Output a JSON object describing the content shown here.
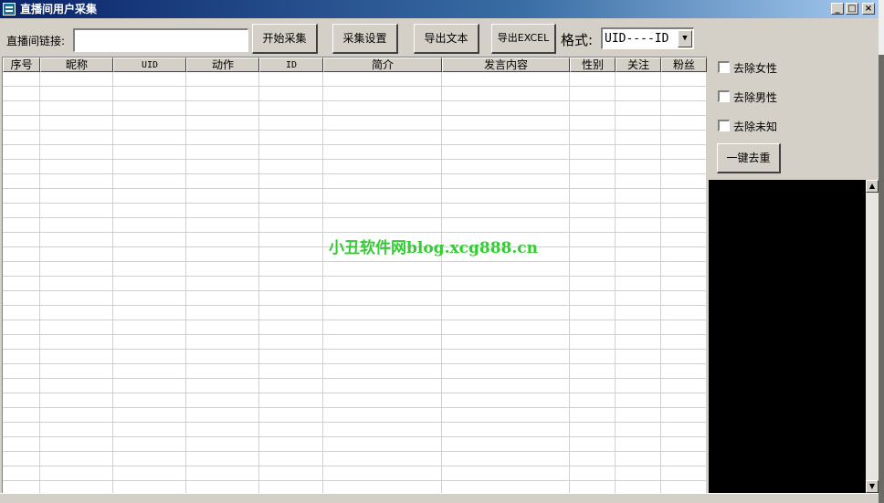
{
  "window": {
    "title": "直播间用户采集",
    "controls": {
      "minimize": "_",
      "maximize": "□",
      "close": "×"
    }
  },
  "toolbar": {
    "link_label": "直播间链接:",
    "link_value": "",
    "start_button": "开始采集",
    "settings_button": "采集设置",
    "export_text_button": "导出文本",
    "export_excel_button": "导出EXCEL",
    "format_label": "格式:",
    "format_selected": "UID----ID"
  },
  "grid": {
    "columns": [
      "序号",
      "昵称",
      "UID",
      "动作",
      "ID",
      "简介",
      "发言内容",
      "性别",
      "关注",
      "粉丝"
    ],
    "rows": []
  },
  "watermark": "小丑软件网blog.xcg888.cn",
  "options": {
    "remove_female": "去除女性",
    "remove_male": "去除男性",
    "remove_unknown": "去除未知",
    "dedupe_button": "一键去重"
  },
  "colors": {
    "titlebar": "#0a246a",
    "face": "#d4d0c8",
    "watermark": "#33cc33",
    "console": "#000000"
  },
  "icons": {
    "app": "app-icon",
    "dropdown": "chevron-down-icon"
  }
}
